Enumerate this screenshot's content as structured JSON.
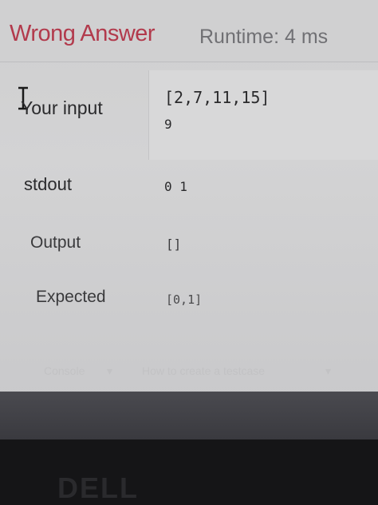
{
  "result": {
    "status": "Wrong Answer",
    "runtime": "Runtime: 4 ms"
  },
  "rows": {
    "input_label": "Your input",
    "input_line1": "[2,7,11,15]",
    "input_line2": "9",
    "stdout_label": "stdout",
    "stdout_value": "0 1",
    "output_label": "Output",
    "output_value": "[]",
    "expected_label": "Expected",
    "expected_value": "[0,1]"
  },
  "footer": {
    "console": "Console",
    "howto": "How to create a testcase"
  },
  "bezel": {
    "brand": "DELL"
  },
  "colors": {
    "status": "#b23a4c",
    "screen_bg": "#d0d0d1"
  }
}
